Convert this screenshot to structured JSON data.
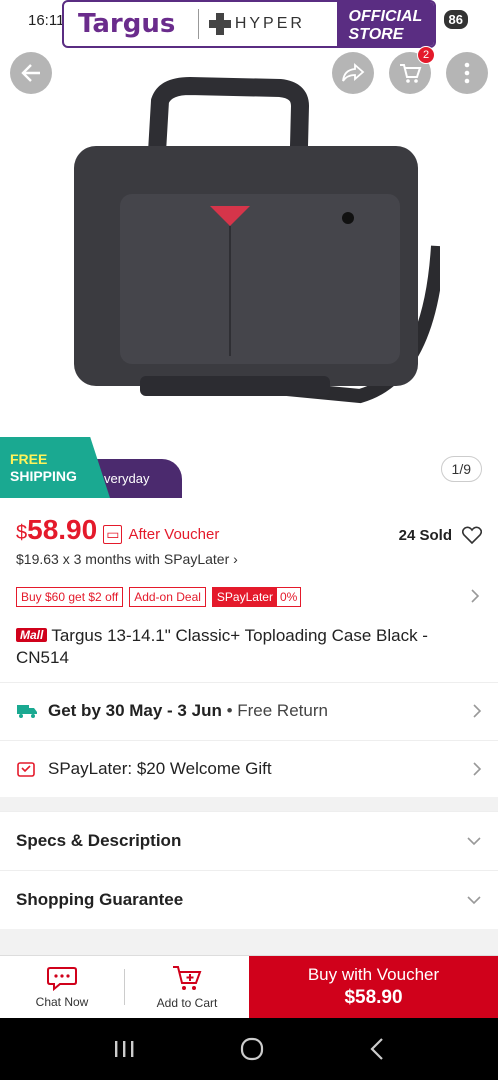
{
  "status_bar": {
    "time": "16:11",
    "battery": "86"
  },
  "banner": {
    "brand": "Targus",
    "partner": "HYPER",
    "official": "OFFICIAL STORE"
  },
  "cart": {
    "badge_count": "2"
  },
  "image": {
    "counter": "1/9"
  },
  "free_shipping": {
    "line1": "FREE",
    "line2": "SHIPPING",
    "line3": "veryday"
  },
  "price": {
    "currency": "$",
    "value": "58.90",
    "after_voucher": "After Voucher",
    "sold": "24 Sold",
    "installment": "$19.63 x 3 months with SPayLater ›"
  },
  "tags": {
    "promo1": "Buy $60 get $2 off",
    "promo2": "Add-on Deal",
    "spaylater": "SPayLater",
    "spaylater_rate": "0%"
  },
  "product": {
    "mall_badge": "Mall",
    "title": "Targus 13-14.1\" Classic+ Toploading Case Black - CN514"
  },
  "delivery": {
    "label": "Get by 30 May - 3 Jun",
    "sub": " • Free Return"
  },
  "spaylater_gift": {
    "label": "SPayLater: $20 Welcome Gift"
  },
  "sections": {
    "specs": "Specs & Description",
    "guarantee": "Shopping Guarantee"
  },
  "bottom_bar": {
    "chat": "Chat Now",
    "add_to_cart": "Add to Cart",
    "buy_line1": "Buy with Voucher",
    "buy_line2": "$58.90"
  },
  "colors": {
    "accent": "#d0011b",
    "price": "#e41a2b",
    "teal": "#1aa991",
    "purple": "#4b2a6e"
  },
  "icons": [
    "back-icon",
    "share-icon",
    "cart-icon",
    "more-icon",
    "heart-icon",
    "truck-icon",
    "gift-icon",
    "chat-icon",
    "add-cart-icon",
    "chevron-right-icon",
    "chevron-down-icon"
  ]
}
